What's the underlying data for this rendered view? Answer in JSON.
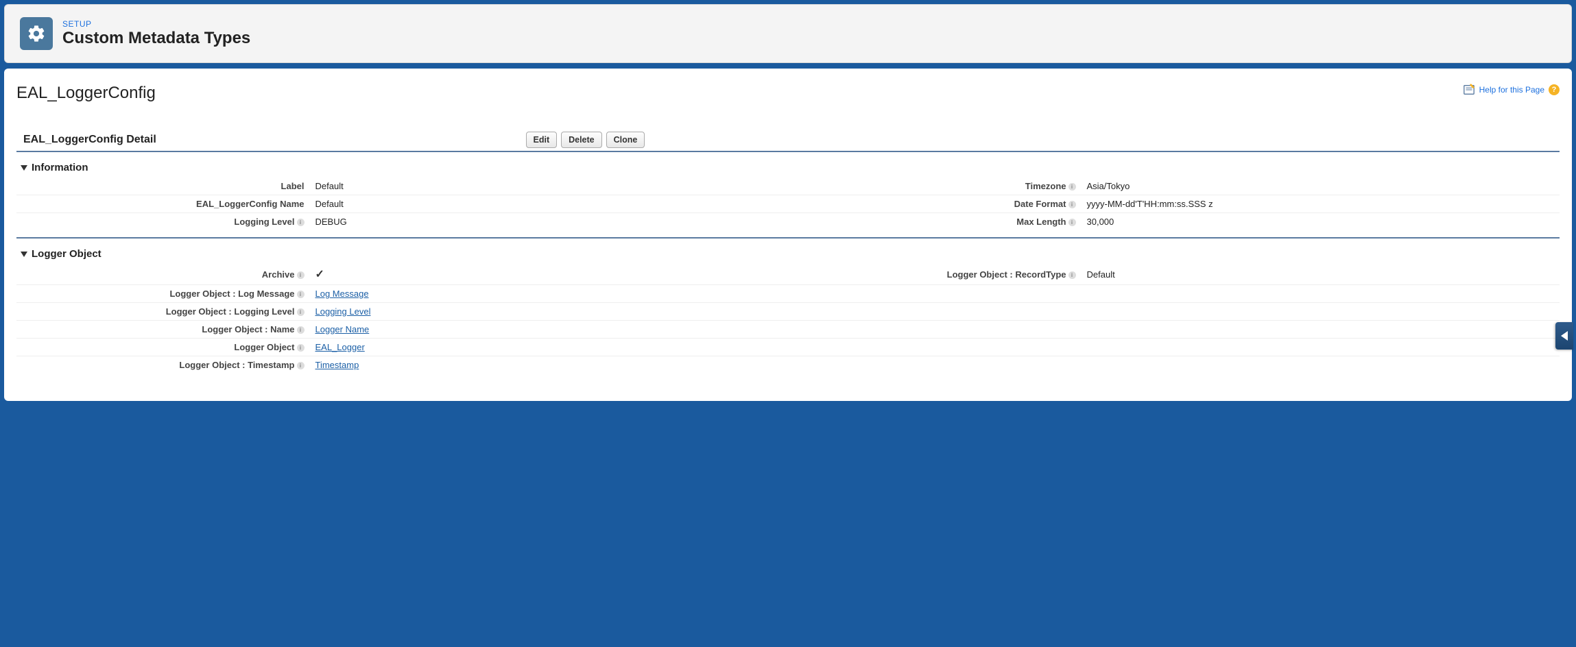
{
  "header": {
    "breadcrumb": "SETUP",
    "title": "Custom Metadata Types"
  },
  "page": {
    "title": "EAL_LoggerConfig",
    "help_text": "Help for this Page"
  },
  "detail": {
    "title": "EAL_LoggerConfig Detail",
    "buttons": {
      "edit": "Edit",
      "delete": "Delete",
      "clone": "Clone"
    }
  },
  "sections": {
    "information": {
      "title": "Information",
      "fields": {
        "label": {
          "label": "Label",
          "value": "Default"
        },
        "timezone": {
          "label": "Timezone",
          "value": "Asia/Tokyo"
        },
        "name": {
          "label": "EAL_LoggerConfig Name",
          "value": "Default"
        },
        "date_format": {
          "label": "Date Format",
          "value": "yyyy-MM-dd'T'HH:mm:ss.SSS z"
        },
        "logging_level": {
          "label": "Logging Level",
          "value": "DEBUG"
        },
        "max_length": {
          "label": "Max Length",
          "value": "30,000"
        }
      }
    },
    "logger_object": {
      "title": "Logger Object",
      "fields": {
        "archive": {
          "label": "Archive",
          "checked": true
        },
        "record_type": {
          "label": "Logger Object : RecordType",
          "value": "Default"
        },
        "log_message": {
          "label": "Logger Object : Log Message",
          "link": "Log Message"
        },
        "logging_level": {
          "label": "Logger Object : Logging Level",
          "link": "Logging Level"
        },
        "name": {
          "label": "Logger Object : Name",
          "link": "Logger Name"
        },
        "object": {
          "label": "Logger Object",
          "link": "EAL_Logger"
        },
        "timestamp": {
          "label": "Logger Object : Timestamp",
          "link": "Timestamp"
        }
      }
    }
  }
}
